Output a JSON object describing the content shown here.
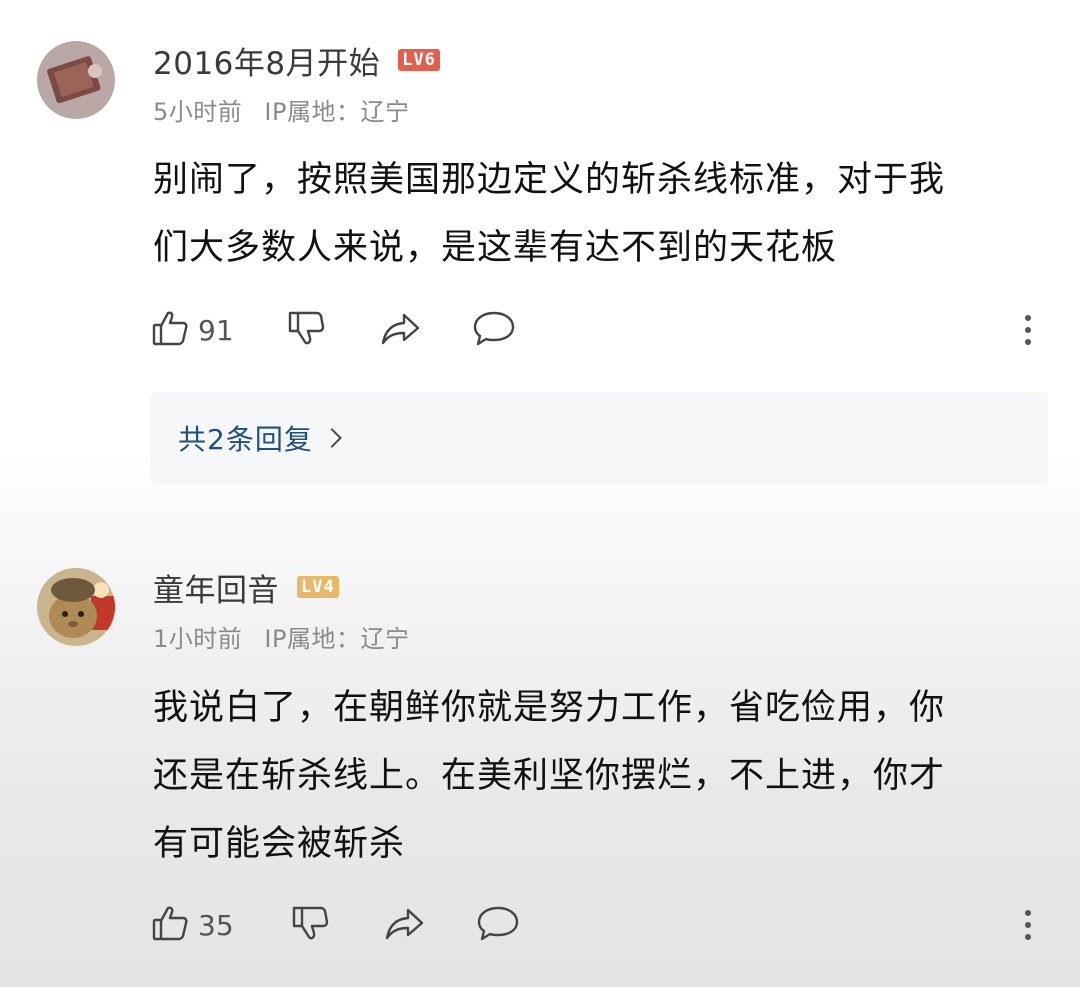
{
  "comments": [
    {
      "username": "2016年8月开始",
      "level": "LV6",
      "level_color": "#e0614f",
      "time": "5小时前",
      "ip_location": "IP属地：辽宁",
      "content_lines": [
        "别闹了，按照美国那边定义的斩杀线标准，对于我",
        "们大多数人来说，是这辈有达不到的天花板"
      ],
      "likes": "91",
      "replies_label": "共2条回复"
    },
    {
      "username": "童年回音",
      "level": "LV4",
      "level_color": "#e8b76a",
      "time": "1小时前",
      "ip_location": "IP属地：辽宁",
      "content_lines": [
        "我说白了，在朝鲜你就是努力工作，省吃俭用，你",
        "还是在斩杀线上。在美利坚你摆烂，不上进，你才",
        "有可能会被斩杀"
      ],
      "likes": "35"
    }
  ],
  "icons": {
    "like": "thumbs-up-icon",
    "dislike": "thumbs-down-icon",
    "share": "share-icon",
    "reply": "comment-bubble-icon",
    "more": "more-vertical-icon"
  }
}
